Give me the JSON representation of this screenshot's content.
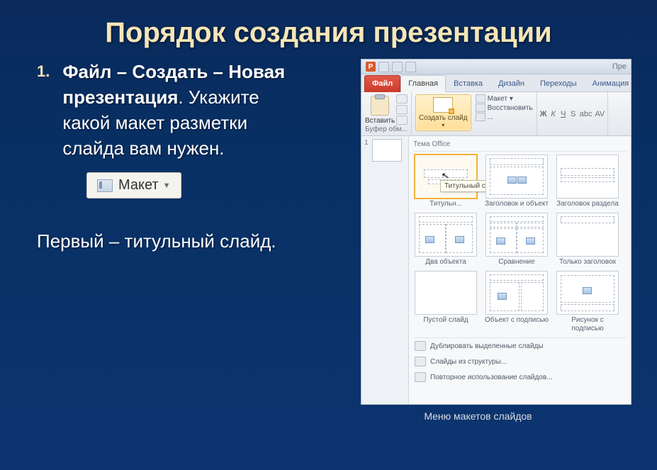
{
  "slide": {
    "title": "Порядок создания презентации",
    "list_number": "1.",
    "step_bold": "Файл – Создать – Новая презентация",
    "step_tail": ". Укажите какой макет разметки слайда вам нужен.",
    "layout_button": "Макет",
    "note": "Первый – титульный слайд.",
    "figure_caption": "Меню макетов слайдов"
  },
  "pp": {
    "app_initial": "P",
    "title_fragment": "Пре",
    "tabs": {
      "file": "Файл",
      "home": "Главная",
      "insert": "Вставка",
      "design": "Дизайн",
      "transitions": "Переходы",
      "animation": "Анимация"
    },
    "ribbon": {
      "paste": "Вставить",
      "clipboard_group": "Буфер обм...",
      "new_slide": "Создать слайд",
      "layout": "Макет",
      "reset": "Восстановить",
      "section": "...",
      "font_b": "Ж",
      "font_i": "К",
      "font_u": "Ч",
      "font_s": "S",
      "font_shadow": "abc",
      "font_spacing": "AV"
    },
    "slide_panel_index": "1",
    "gallery_header": "Тема Office",
    "layouts": [
      "Титульн...",
      "Заголовок и объект",
      "Заголовок раздела",
      "Два объекта",
      "Сравнение",
      "Только заголовок",
      "Пустой слайд",
      "Объект с подписью",
      "Рисунок с подписью"
    ],
    "tooltip": "Титульный слайд",
    "footer": {
      "duplicate": "Дублировать выделенные слайды",
      "outline": "Слайды из структуры...",
      "reuse": "Повторное использование слайдов..."
    }
  }
}
